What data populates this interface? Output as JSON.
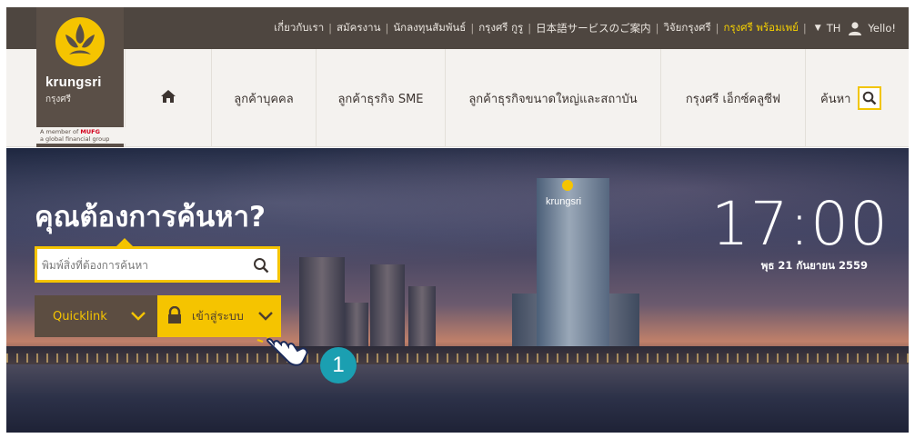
{
  "topbar": {
    "links": [
      {
        "label": "เกี่ยวกับเรา",
        "highlight": false
      },
      {
        "label": "สมัครงาน",
        "highlight": false
      },
      {
        "label": "นักลงทุนสัมพันธ์",
        "highlight": false
      },
      {
        "label": "กรุงศรี กูรู",
        "highlight": false
      },
      {
        "label": "日本語サービスのご案内",
        "highlight": false
      },
      {
        "label": "วิจัยกรุงศรี",
        "highlight": false
      },
      {
        "label": "กรุงศรี พร้อมเพย์",
        "highlight": true
      }
    ],
    "separator": "|",
    "language": "TH",
    "user_label": "Yello!",
    "user_icon": "user-icon",
    "caret_icon": "caret-down-icon"
  },
  "logo": {
    "wordmark": "krungsri",
    "thai": "กรุงศรี",
    "member_line1": "A member of",
    "member_brand": "MUFG",
    "member_line2": "a global financial group"
  },
  "nav": {
    "home_icon": "home-icon",
    "items": [
      {
        "label": "ลูกค้าบุคคล"
      },
      {
        "label": "ลูกค้าธุรกิจ SME"
      },
      {
        "label": "ลูกค้าธุรกิจขนาดใหญ่และสถาบัน"
      },
      {
        "label": "กรุงศรี เอ็กซ์คลูซีฟ"
      }
    ],
    "search_label": "ค้นหา",
    "search_icon": "search-icon"
  },
  "hero": {
    "title": "คุณต้องการค้นหา?",
    "search_placeholder": "พิมพ์สิ่งที่ต้องการค้นหา",
    "quicklink_label": "Quicklink",
    "login_label": "เข้าสู่ระบบ",
    "building_sign": "krungsri",
    "clock": "17:00",
    "date": "พุธ 21 กันยายน 2559",
    "step_number": "1"
  },
  "colors": {
    "accent_yellow": "#f5c400",
    "topbar_brown": "#4e4640",
    "nav_bg": "#f4f2ef",
    "step_teal": "#1b9fb1"
  }
}
